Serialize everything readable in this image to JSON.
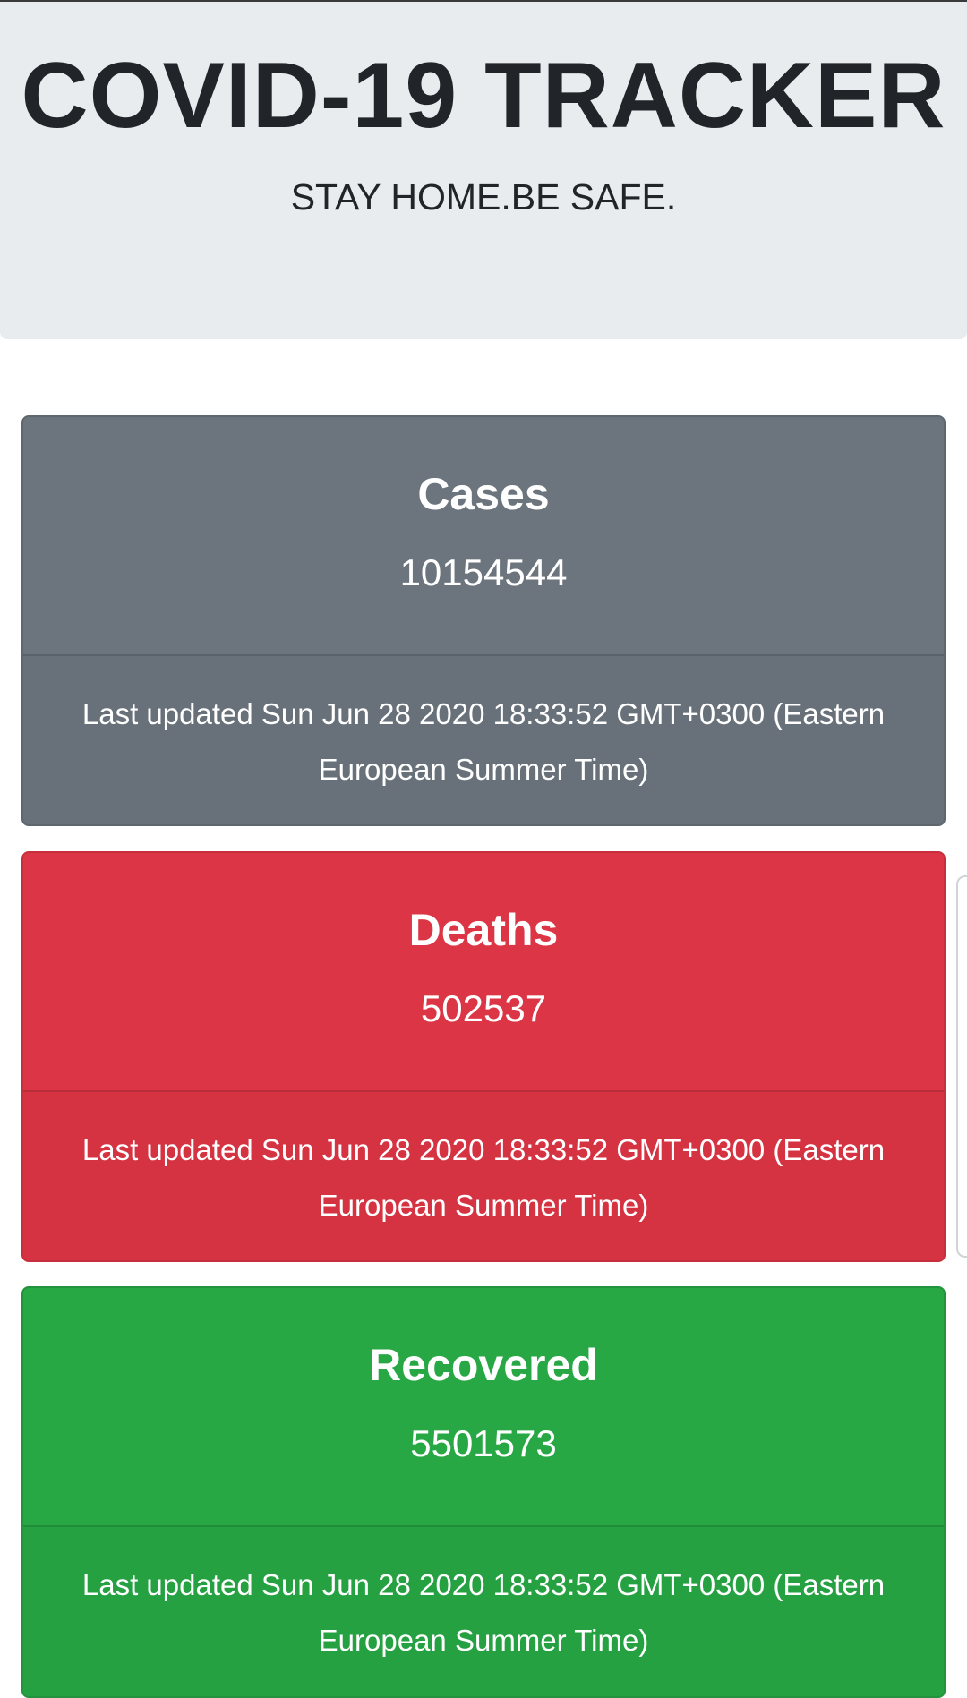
{
  "header": {
    "title": "COVID-19 TRACKER",
    "subtitle": "STAY HOME.BE SAFE."
  },
  "cards": [
    {
      "title": "Cases",
      "value": "10154544",
      "footer": "Last updated Sun Jun 28 2020 18:33:52 GMT+0300 (Eastern European Summer Time)",
      "color": "#6c757d"
    },
    {
      "title": "Deaths",
      "value": "502537",
      "footer": "Last updated Sun Jun 28 2020 18:33:52 GMT+0300 (Eastern European Summer Time)",
      "color": "#dc3545"
    },
    {
      "title": "Recovered",
      "value": "5501573",
      "footer": "Last updated Sun Jun 28 2020 18:33:52 GMT+0300 (Eastern European Summer Time)",
      "color": "#28a745"
    }
  ]
}
